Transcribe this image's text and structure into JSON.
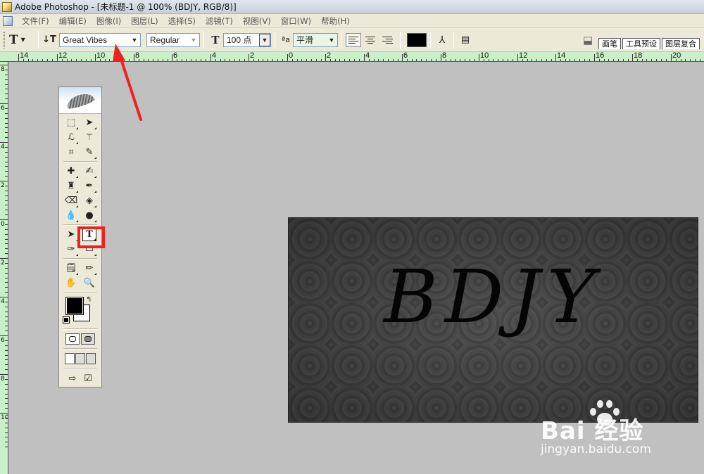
{
  "window": {
    "title": "Adobe Photoshop - [未标题-1 @ 100% (BDJY, RGB/8)]"
  },
  "menu": {
    "items": [
      "文件(F)",
      "编辑(E)",
      "图像(I)",
      "图层(L)",
      "选择(S)",
      "滤镜(T)",
      "视图(V)",
      "窗口(W)",
      "帮助(H)"
    ]
  },
  "options": {
    "font_family": "Great Vibes",
    "font_style": "Regular",
    "font_size": "100 点",
    "antialias": "平滑",
    "text_color": "#000000"
  },
  "palette_tabs": [
    "画笔",
    "工具预设",
    "图层复合"
  ],
  "ruler": {
    "h_labels": [
      "14",
      "12",
      "10",
      "8",
      "6",
      "4",
      "2",
      "0",
      "2",
      "4",
      "6",
      "8",
      "10",
      "12",
      "14",
      "16",
      "18",
      "20"
    ],
    "v_labels": [
      "8",
      "6",
      "4",
      "2",
      "0",
      "2",
      "4",
      "6",
      "8",
      "10"
    ]
  },
  "toolbox": {
    "rows": [
      [
        "marquee-icon",
        "move-icon"
      ],
      [
        "lasso-icon",
        "magic-wand-icon"
      ],
      [
        "crop-icon",
        "slice-icon"
      ],
      [
        "healing-brush-icon",
        "brush-icon"
      ],
      [
        "clone-stamp-icon",
        "history-brush-icon"
      ],
      [
        "eraser-icon",
        "paint-bucket-icon"
      ],
      [
        "blur-icon",
        "dodge-icon"
      ],
      [
        "path-select-icon",
        "type-tool-icon"
      ],
      [
        "pen-icon",
        "shape-icon"
      ],
      [
        "notes-icon",
        "eyedropper-icon"
      ],
      [
        "hand-icon",
        "zoom-icon"
      ]
    ],
    "foreground_color": "#000000",
    "background_color": "#ffffff"
  },
  "canvas": {
    "text": "BDJY"
  },
  "watermark": {
    "brand": "Bai  经验",
    "site": "jingyan.baidu.com"
  },
  "annotations": {
    "highlight_color": "#ee2020"
  }
}
